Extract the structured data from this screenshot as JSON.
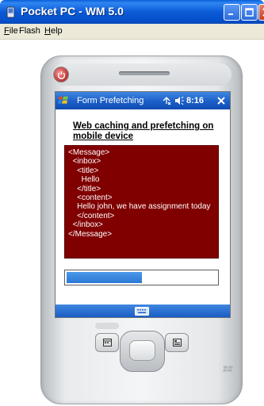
{
  "window": {
    "title": "Pocket PC - WM 5.0",
    "icons": {
      "app": "pda-app-icon",
      "minimize": "minimize-icon",
      "maximize": "maximize-icon",
      "close": "close-icon"
    }
  },
  "menubar": {
    "items": [
      {
        "mnemonic": "F",
        "rest": "ile"
      },
      {
        "mnemonic": "",
        "rest": "Flash"
      },
      {
        "mnemonic": "H",
        "rest": "elp"
      }
    ]
  },
  "device": {
    "titlebar": {
      "app_name": "Form Prefetching",
      "time": "8:16",
      "icons": {
        "start": "windows-flag-icon",
        "connectivity": "connectivity-icon",
        "volume": "volume-icon",
        "close": "close-icon"
      }
    },
    "heading": "Web caching and prefetching on mobile device",
    "xml_text": "<Message>\n  <inbox>\n    <title>\n      Hello\n    </title>\n    <content>\n    Hello john, we have assignment today\n    </content>\n  </inbox>\n</Message>",
    "progress_fraction": 0.5,
    "softbar": {
      "keyboard_icon": "keyboard-icon"
    }
  },
  "colors": {
    "xp_titlebar": "#0b5bd7",
    "pda_titlebar": "#1c5fc8",
    "xml_box_bg": "#800000",
    "progress_fill": "#2a78d6"
  }
}
